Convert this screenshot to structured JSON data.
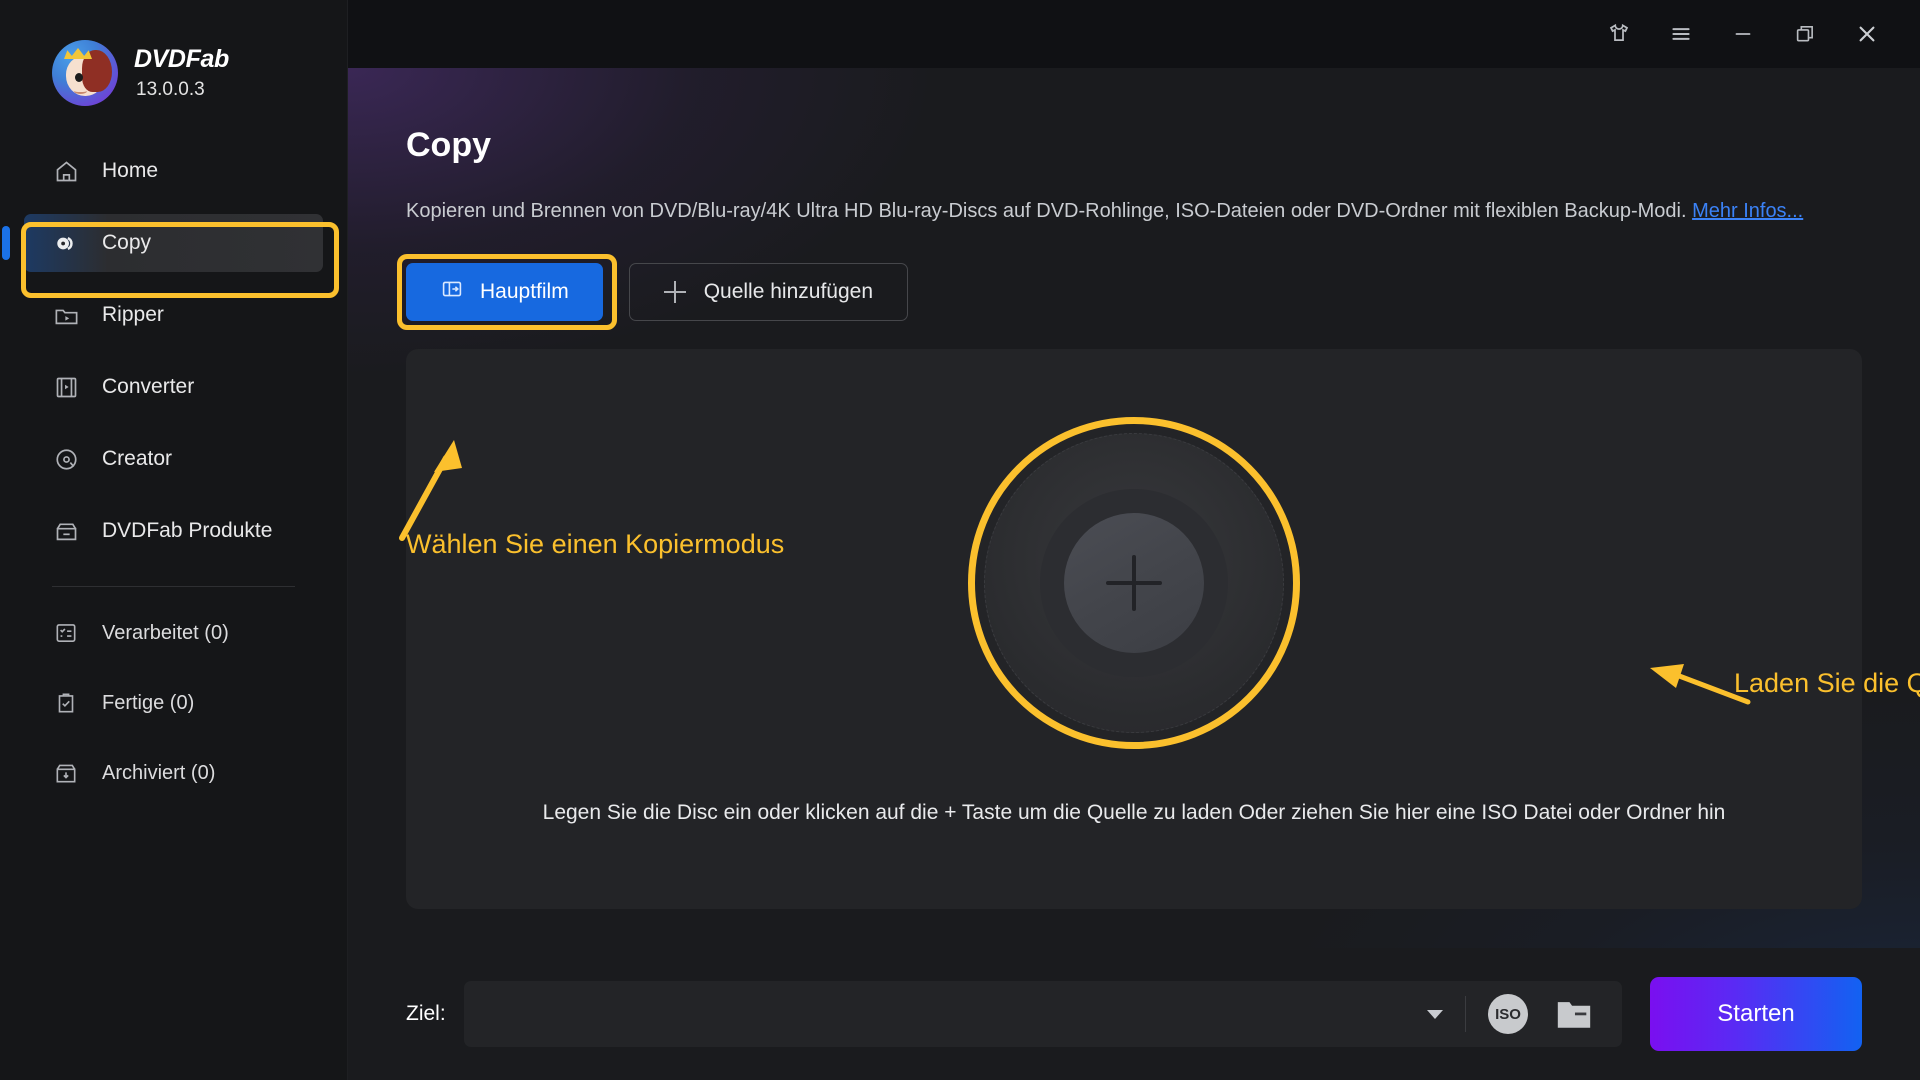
{
  "app": {
    "brand_name": "DVDFab",
    "version": "13.0.0.3"
  },
  "titlebar": {
    "theme_icon": "tshirt-icon",
    "menu_icon": "hamburger-menu-icon",
    "minimize_icon": "minimize-icon",
    "maximize_icon": "restore-window-icon",
    "close_icon": "close-icon"
  },
  "sidebar": {
    "items": [
      {
        "label": "Home",
        "icon": "home-icon",
        "active": false
      },
      {
        "label": "Copy",
        "icon": "disc-copy-icon",
        "active": true
      },
      {
        "label": "Ripper",
        "icon": "folder-play-icon",
        "active": false
      },
      {
        "label": "Converter",
        "icon": "film-strip-icon",
        "active": false
      },
      {
        "label": "Creator",
        "icon": "disc-creator-icon",
        "active": false
      },
      {
        "label": "DVDFab Produkte",
        "icon": "box-icon",
        "active": false
      }
    ],
    "secondary_items": [
      {
        "label": "Verarbeitet (0)",
        "icon": "task-list-icon"
      },
      {
        "label": "Fertige (0)",
        "icon": "clipboard-check-icon"
      },
      {
        "label": "Archiviert (0)",
        "icon": "archive-box-icon"
      }
    ]
  },
  "main": {
    "title": "Copy",
    "description_part1": "Kopieren und Brennen von DVD/Blu-ray/4K Ultra HD Blu-ray-Discs auf DVD-Rohlinge, ISO-Dateien oder DVD-Ordner mit flexiblen Backup-Modi. ",
    "description_link": "Mehr Infos...",
    "mode_button": "Hauptfilm",
    "mode_button_icon": "copy-mode-icon",
    "add_source_button": "Quelle hinzufügen",
    "add_source_icon": "plus-icon",
    "drop_hint": "Legen Sie die Disc ein oder klicken auf die + Taste um die Quelle zu laden Oder ziehen Sie hier eine ISO Datei oder Ordner hin",
    "disc_plus_icon": "plus-icon"
  },
  "annotations": {
    "mode_text": "Wählen Sie einen Kopiermodus",
    "load_text": "Laden Sie die Quelldatei",
    "highlight_color": "#fbc02d"
  },
  "bottom": {
    "dest_label": "Ziel:",
    "dest_value": "",
    "dest_placeholder": "",
    "dropdown_icon": "chevron-down-icon",
    "iso_button": "ISO",
    "folder_icon": "folder-icon",
    "start_button": "Starten"
  },
  "colors": {
    "accent_blue": "#1769e0",
    "highlight_yellow": "#fbc02d",
    "link_blue": "#3b82f6",
    "sidebar_bg": "#151618",
    "content_bg": "#1a1b1e",
    "panel_bg": "#232427",
    "start_gradient_from": "#7a0ff0",
    "start_gradient_to": "#1262f2"
  }
}
